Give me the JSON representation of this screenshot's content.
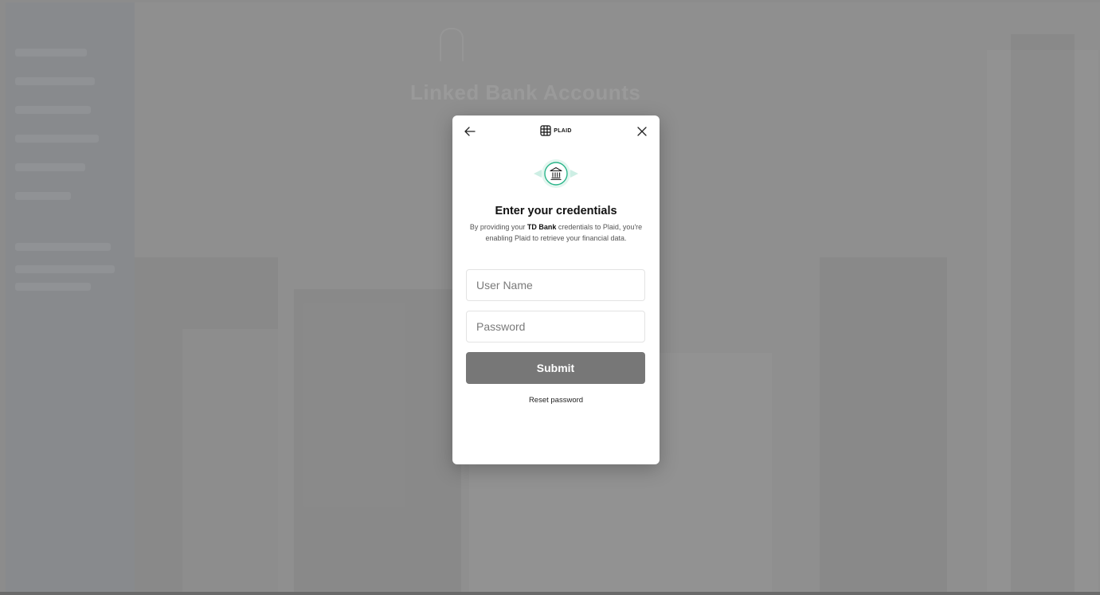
{
  "background": {
    "heading": "Linked Bank Accounts"
  },
  "modal": {
    "brand": "PLAID",
    "back_icon": "arrow-left-icon",
    "close_icon": "close-icon",
    "bank_icon": "bank-icon",
    "title": "Enter your credentials",
    "description_prefix": "By providing your ",
    "bank_name": "TD Bank",
    "description_suffix": " credentials to Plaid, you're enabling Plaid to retrieve your financial data.",
    "username_placeholder": "User Name",
    "password_placeholder": "Password",
    "submit_label": "Submit",
    "reset_label": "Reset password"
  },
  "colors": {
    "overlay": "#8d8d8d",
    "submit_bg": "#777777",
    "bank_accent": "#2bb58a"
  }
}
